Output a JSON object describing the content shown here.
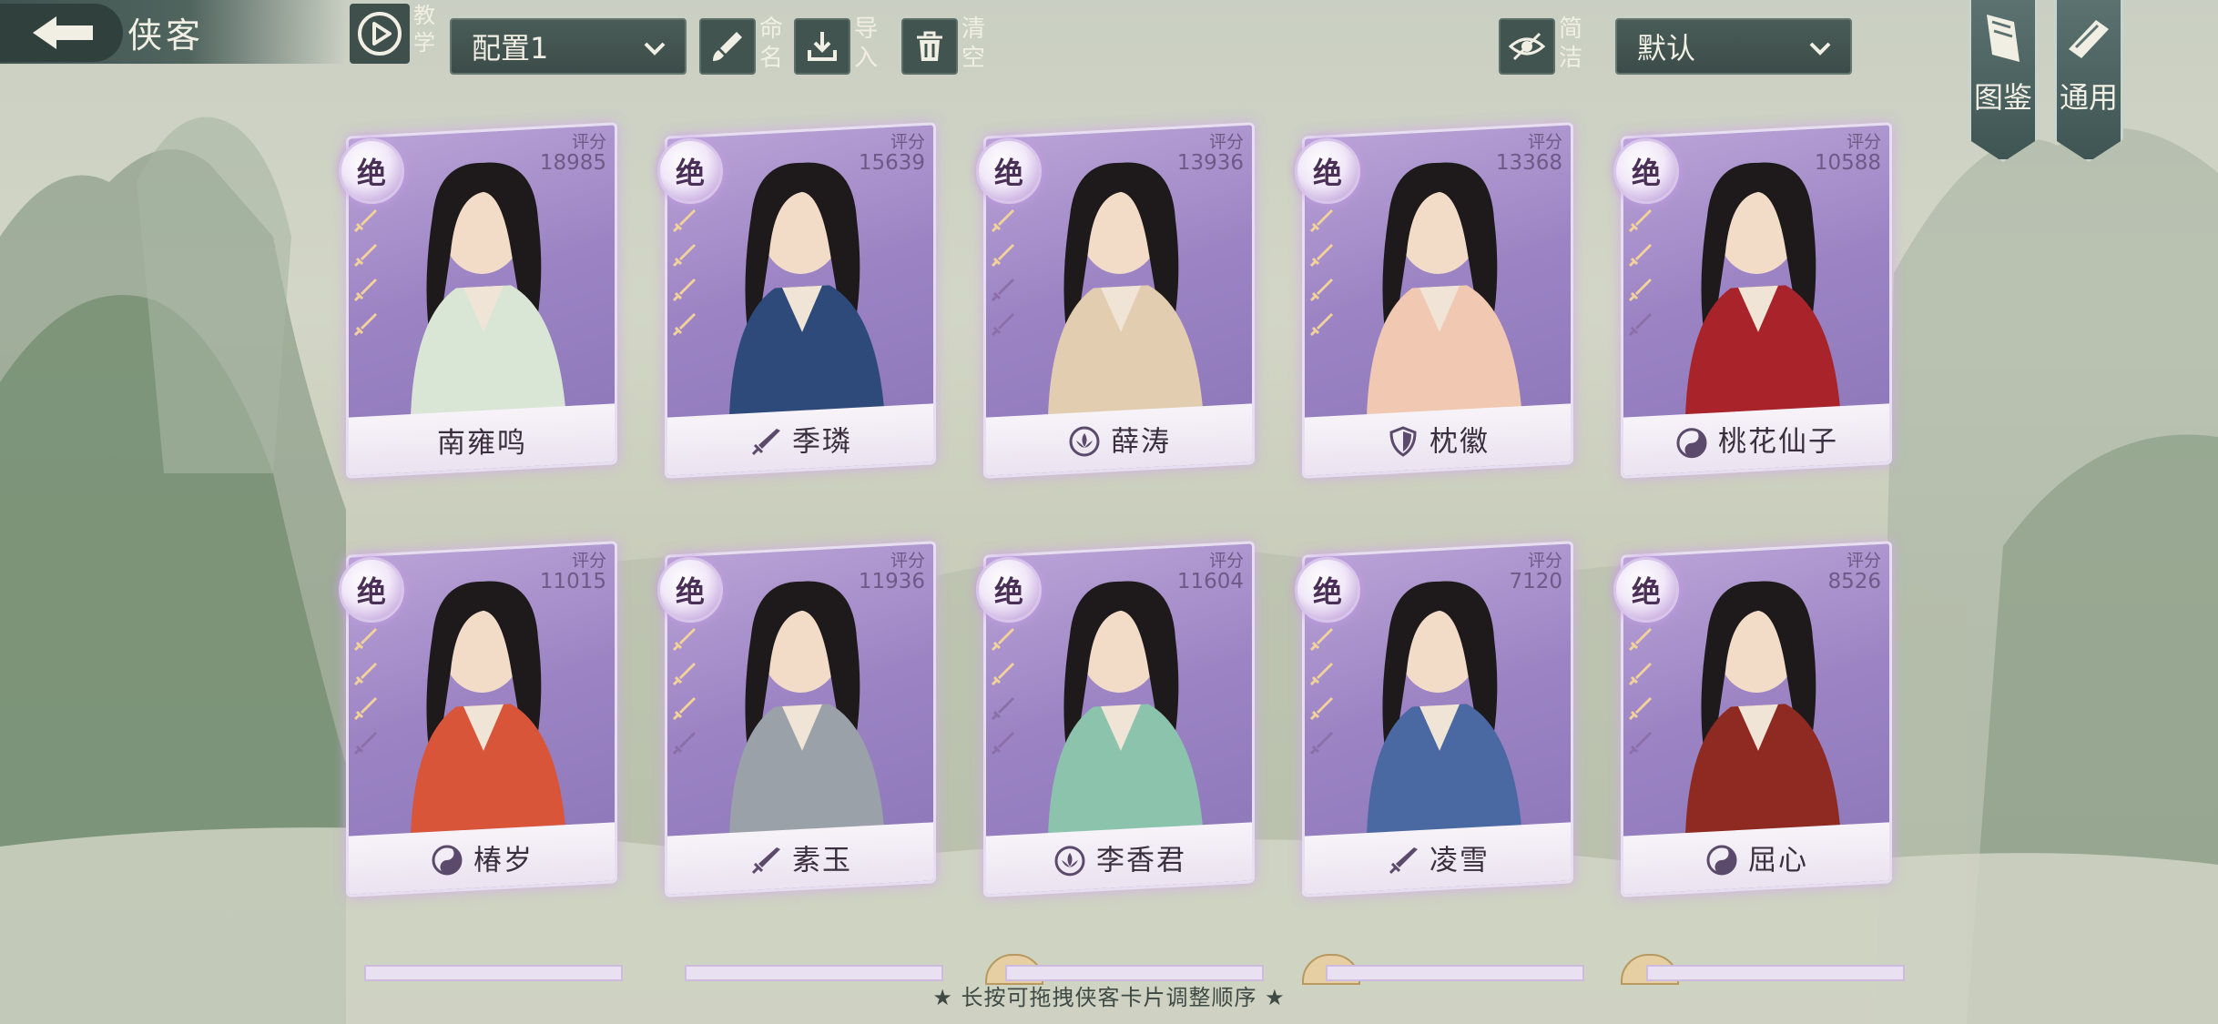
{
  "header": {
    "title": "侠客",
    "tutorial_label": "教学",
    "config_select": "配置1",
    "rename_label": "命名",
    "import_label": "导入",
    "clear_label": "清空",
    "simple_label": "简洁",
    "sort_select": "默认",
    "codex_label": "图鉴",
    "general_label": "通用"
  },
  "score_label": "评分",
  "cards": [
    {
      "name": "南雍鸣",
      "rank": "绝",
      "score": "18985",
      "stars": 4,
      "class_icon": "none",
      "color": "#d9e6d5"
    },
    {
      "name": "季璘",
      "rank": "绝",
      "score": "15639",
      "stars": 4,
      "class_icon": "sword-icon",
      "color": "#2d4a7a"
    },
    {
      "name": "薛涛",
      "rank": "绝",
      "score": "13936",
      "stars": 2,
      "class_icon": "lotus-icon",
      "color": "#e2cdb0"
    },
    {
      "name": "枕徽",
      "rank": "绝",
      "score": "13368",
      "stars": 4,
      "class_icon": "shield-icon",
      "color": "#f1c8b2"
    },
    {
      "name": "桃花仙子",
      "rank": "绝",
      "score": "10588",
      "stars": 3,
      "class_icon": "yin-yang-icon",
      "color": "#a8232a"
    },
    {
      "name": "椿岁",
      "rank": "绝",
      "score": "11015",
      "stars": 3,
      "class_icon": "yin-yang-icon",
      "color": "#d8553a"
    },
    {
      "name": "素玉",
      "rank": "绝",
      "score": "11936",
      "stars": 3,
      "class_icon": "sword-icon",
      "color": "#9aa1a8"
    },
    {
      "name": "李香君",
      "rank": "绝",
      "score": "11604",
      "stars": 2,
      "class_icon": "lotus-icon",
      "color": "#8cc3ad"
    },
    {
      "name": "凌雪",
      "rank": "绝",
      "score": "7120",
      "stars": 3,
      "class_icon": "sword-icon",
      "color": "#4a68a2"
    },
    {
      "name": "屈心",
      "rank": "绝",
      "score": "8526",
      "stars": 3,
      "class_icon": "yin-yang-icon",
      "color": "#8f2a22"
    }
  ],
  "hint": "★ 长按可拖拽侠客卡片调整顺序 ★"
}
